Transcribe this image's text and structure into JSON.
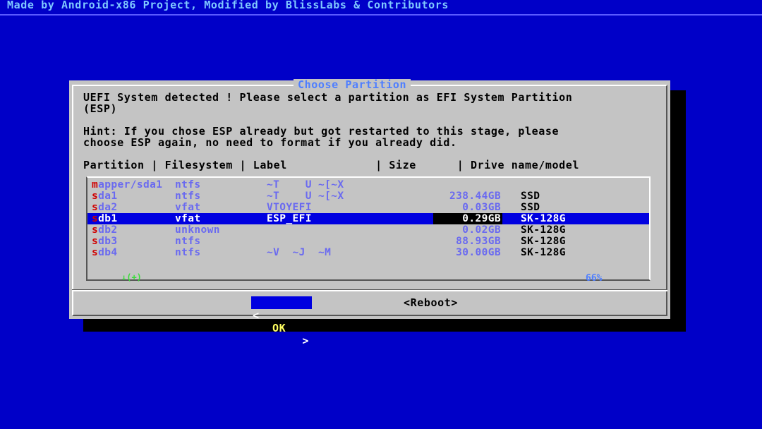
{
  "backtitle": "Made by Android-x86 Project, Modified by BlissLabs & Contributors",
  "dialog": {
    "title": "Choose Partition",
    "message": "UEFI System detected ! Please select a partition as EFI System Partition\n(ESP)",
    "hint": "Hint: If you chose ESP already but got restarted to this stage, please\nchoose ESP again, no need to format if you already did.",
    "header": "Partition | Filesystem | Label             | Size      | Drive name/model",
    "rows": [
      {
        "hot": "m",
        "rest": "apper/sda1",
        "fs": "ntfs",
        "label": "~T    U ~[~X",
        "size": "",
        "drive": ""
      },
      {
        "hot": "s",
        "rest": "da1",
        "fs": "ntfs",
        "label": "~T    U ~[~X",
        "size": "238.44GB",
        "drive": "SSD"
      },
      {
        "hot": "s",
        "rest": "da2",
        "fs": "vfat",
        "label": "VTOYEFI",
        "size": "0.03GB",
        "drive": "SSD"
      },
      {
        "hot": "s",
        "rest": "db1",
        "fs": "vfat",
        "label": "ESP_EFI",
        "size": "0.29GB",
        "drive": "SK-128G"
      },
      {
        "hot": "s",
        "rest": "db2",
        "fs": "unknown",
        "label": "",
        "size": "0.02GB",
        "drive": "SK-128G"
      },
      {
        "hot": "s",
        "rest": "db3",
        "fs": "ntfs",
        "label": "",
        "size": "88.93GB",
        "drive": "SK-128G"
      },
      {
        "hot": "s",
        "rest": "db4",
        "fs": "ntfs",
        "label": "~V  ~J  ~M",
        "size": "30.00GB",
        "drive": "SK-128G"
      }
    ],
    "selected_row": 3,
    "scroll_indicator": "↓(+)",
    "scroll_percent": "66%",
    "buttons": {
      "ok": {
        "left": "<",
        "label": "OK",
        "right": ">"
      },
      "reboot": "<Reboot>"
    }
  },
  "colors": {
    "background": "#0000c8",
    "dialog": "#c4c4c4",
    "title": "#4f7fff",
    "highlight": "#0000e0",
    "hotkey": "#d00000"
  }
}
